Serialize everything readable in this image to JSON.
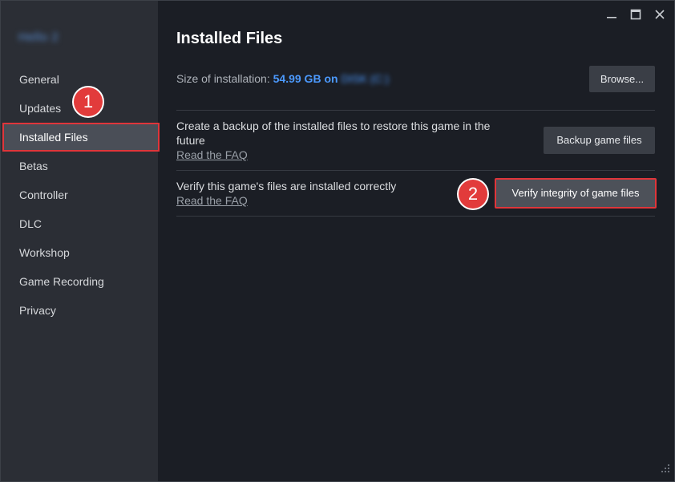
{
  "window": {
    "controls": {
      "minimize": "minimize-icon",
      "maximize": "maximize-icon",
      "close": "close-icon"
    }
  },
  "sidebar": {
    "game_title": "Hello 2",
    "items": [
      {
        "label": "General"
      },
      {
        "label": "Updates"
      },
      {
        "label": "Installed Files",
        "active": true
      },
      {
        "label": "Betas"
      },
      {
        "label": "Controller"
      },
      {
        "label": "DLC"
      },
      {
        "label": "Workshop"
      },
      {
        "label": "Game Recording"
      },
      {
        "label": "Privacy"
      }
    ]
  },
  "annotations": {
    "step1": "1",
    "step2": "2",
    "highlight_color": "#e0353a"
  },
  "main": {
    "title": "Installed Files",
    "size_label": "Size of installation:",
    "size_value": "54.99 GB on",
    "size_drive": "DISK (C:)",
    "browse_button": "Browse...",
    "backup": {
      "text": "Create a backup of the installed files to restore this game in the future",
      "faq": "Read the FAQ",
      "button": "Backup game files"
    },
    "verify": {
      "text": "Verify this game's files are installed correctly",
      "faq": "Read the FAQ",
      "button": "Verify integrity of game files"
    }
  },
  "colors": {
    "accent": "#4c9aff",
    "background": "#1b1e25",
    "sidebar": "#2b2e35"
  }
}
